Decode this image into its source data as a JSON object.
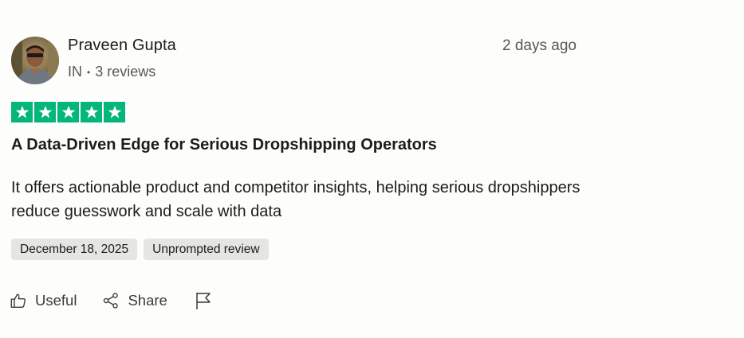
{
  "reviewer": {
    "name": "Praveen Gupta",
    "country": "IN",
    "reviews": "3 reviews",
    "avatar_icon": "avatar-photo"
  },
  "review": {
    "posted_ago": "2 days ago",
    "rating": 5,
    "rating_max": 5,
    "star_color": "#04b67a",
    "title": "A Data-Driven Edge for Serious Dropshipping Operators",
    "body": "It offers actionable product and competitor insights, helping serious dropshippers reduce guesswork and scale with data",
    "date": "December 18, 2025",
    "label": "Unprompted review"
  },
  "actions": {
    "useful_label": "Useful",
    "useful_icon": "thumbs-up-icon",
    "share_label": "Share",
    "share_icon": "share-icon",
    "flag_icon": "flag-icon"
  }
}
